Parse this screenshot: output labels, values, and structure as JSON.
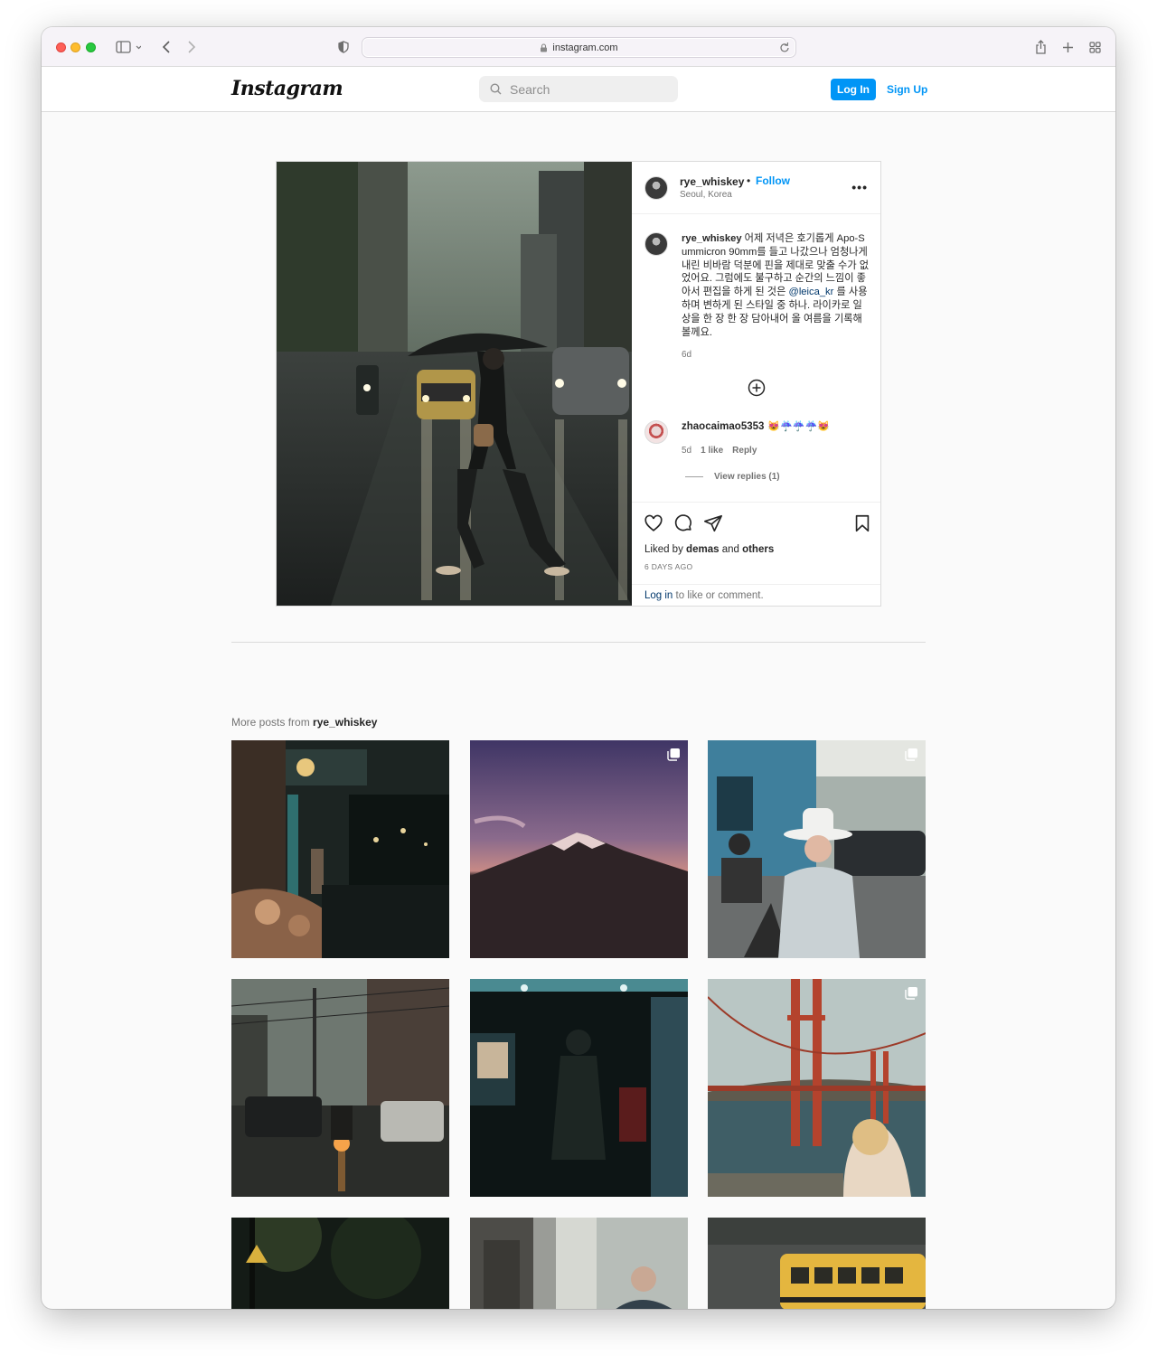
{
  "browser": {
    "url": "instagram.com"
  },
  "header": {
    "logo": "Instagram",
    "search_placeholder": "Search",
    "login_label": "Log In",
    "signup_label": "Sign Up"
  },
  "post": {
    "username": "rye_whiskey",
    "separator": "•",
    "follow_label": "Follow",
    "location": "Seoul, Korea",
    "more_label": "•••",
    "caption_user": "rye_whiskey",
    "caption_text_1": "어제 저녁은 호기롭게 Apo-Summicron 90mm를 들고 나갔으나 엄청나게 내린 비바람 덕분에 핀을 제대로 맞출 수가 없었어요. 그럼에도 불구하고 순간의 느낌이 좋아서 편집을 하게 된 것은",
    "caption_mention": "@leica_kr",
    "caption_text_2": "를 사용하며 변하게 된 스타일 중 하나. 라이카로 일상을 한 장 한 장 담아내어 올 여름을 기록해볼께요.",
    "caption_time": "6d",
    "comment": {
      "username": "zhaocaimao5353",
      "emojis": "😻☔☔☔😻",
      "time": "5d",
      "likes": "1 like",
      "reply_label": "Reply",
      "view_replies": "View replies (1)"
    },
    "liked_prefix": "Liked by",
    "liked_user": "demas",
    "liked_and": "and",
    "liked_others": "others",
    "date": "6 DAYS AGO",
    "login_link": "Log in",
    "login_suffix": "to like or comment."
  },
  "more_posts": {
    "prefix": "More posts from",
    "username": "rye_whiskey"
  },
  "icons": {
    "like": "heart-icon",
    "comment": "comment-icon",
    "share": "paper-plane-icon",
    "save": "bookmark-icon",
    "multi": "carousel-icon"
  }
}
